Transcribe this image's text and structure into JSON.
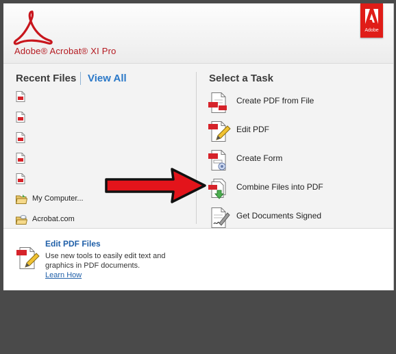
{
  "header": {
    "app_title": "Adobe® Acrobat® XI Pro",
    "badge_text": "Adobe",
    "brand_color": "#e01d18",
    "logo_icon": "acrobat-swirl-icon"
  },
  "recent": {
    "heading": "Recent Files",
    "view_all": "View All",
    "items": [
      {
        "label": "",
        "icon": "pdf-file-icon"
      },
      {
        "label": "",
        "icon": "pdf-file-icon"
      },
      {
        "label": "",
        "icon": "pdf-file-icon"
      },
      {
        "label": "",
        "icon": "pdf-file-icon"
      },
      {
        "label": "",
        "icon": "pdf-file-icon"
      },
      {
        "label": "My Computer...",
        "icon": "folder-open-icon"
      },
      {
        "label": "Acrobat.com",
        "icon": "cloud-folder-icon"
      }
    ]
  },
  "tasks": {
    "heading": "Select a Task",
    "items": [
      {
        "label": "Create PDF from File",
        "icon": "create-pdf-icon"
      },
      {
        "label": "Edit PDF",
        "icon": "edit-pdf-icon"
      },
      {
        "label": "Create Form",
        "icon": "create-form-icon"
      },
      {
        "label": "Combine Files into PDF",
        "icon": "combine-files-icon"
      },
      {
        "label": "Get Documents Signed",
        "icon": "sign-document-icon"
      }
    ]
  },
  "tip": {
    "title": "Edit PDF Files",
    "description": "Use new tools to easily edit text and graphics in PDF documents.",
    "link": "Learn How",
    "icon": "edit-pdf-icon"
  },
  "annotation": {
    "arrow_color": "#e3141b",
    "arrow_icon": "red-arrow-icon"
  }
}
